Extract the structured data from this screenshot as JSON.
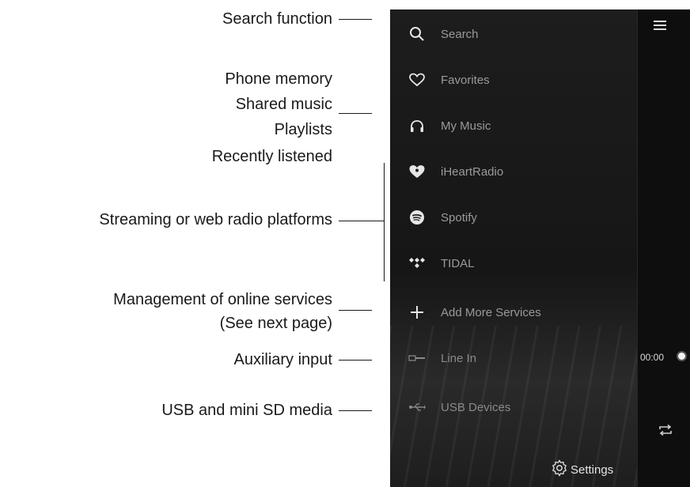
{
  "annotations": {
    "search": "Search function",
    "phone_memory": "Phone memory",
    "shared_music": "Shared music",
    "playlists": "Playlists",
    "recently": "Recently listened",
    "streaming": "Streaming or web radio platforms",
    "manage_line1": "Management of online services",
    "manage_line2": "(See next page)",
    "aux": "Auxiliary input",
    "usb": "USB and mini SD media"
  },
  "menu": {
    "items": [
      {
        "label": "Search",
        "icon": "search-icon"
      },
      {
        "label": "Favorites",
        "icon": "heart-icon"
      },
      {
        "label": "My Music",
        "icon": "headphones-icon"
      },
      {
        "label": "iHeartRadio",
        "icon": "iheartradio-icon"
      },
      {
        "label": "Spotify",
        "icon": "spotify-icon"
      },
      {
        "label": "TIDAL",
        "icon": "tidal-icon"
      },
      {
        "label": "Add More Services",
        "icon": "plus-icon"
      },
      {
        "label": "Line In",
        "icon": "line-in-icon"
      },
      {
        "label": "USB Devices",
        "icon": "usb-icon"
      }
    ],
    "settings_label": "Settings"
  },
  "player": {
    "time": "00:00"
  },
  "colors": {
    "background": "#ffffff",
    "drawer": "#1d1d1d",
    "text_dim": "#9a9a9a",
    "icon": "#e6e6e6"
  }
}
